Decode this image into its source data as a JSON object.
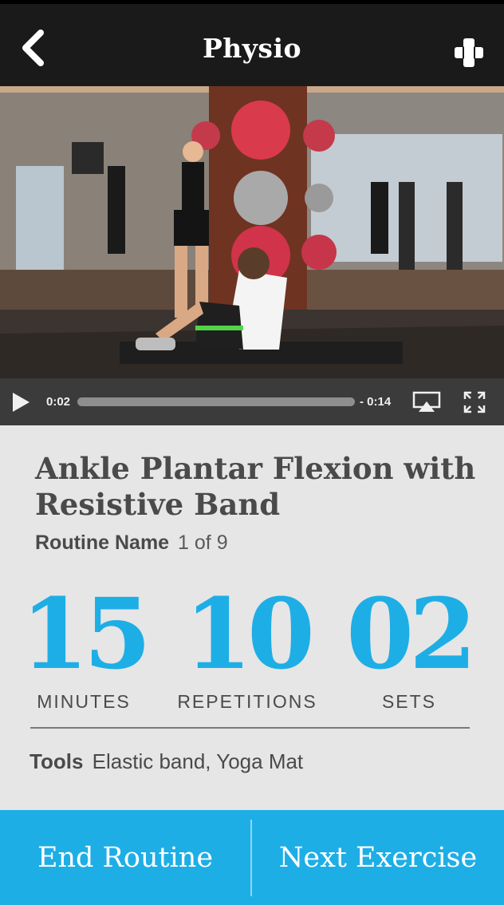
{
  "header": {
    "title": "Physio",
    "back_icon": "chevron-left-icon",
    "logo_icon": "physio-cross-logo"
  },
  "video": {
    "current_time": "0:02",
    "remaining_time": "- 0:14",
    "progress": 0.0,
    "play_icon": "play-icon",
    "airplay_icon": "airplay-icon",
    "fullscreen_icon": "fullscreen-icon"
  },
  "exercise": {
    "title": "Ankle Plantar Flexion with Resistive Band",
    "routine_name": "Routine Name",
    "routine_progress": "1 of 9"
  },
  "stats": {
    "minutes": {
      "value": "15",
      "label": "MINUTES"
    },
    "repetitions": {
      "value": "10",
      "label": "REPETITIONS"
    },
    "sets": {
      "value": "02",
      "label": "SETS"
    }
  },
  "tools": {
    "label": "Tools",
    "value": "Elastic band, Yoga Mat"
  },
  "footer": {
    "end_label": "End Routine",
    "next_label": "Next Exercise"
  },
  "colors": {
    "accent": "#1eaee6",
    "appbar": "#1a1a1a",
    "background": "#e6e6e6",
    "text": "#4a4a4a"
  }
}
